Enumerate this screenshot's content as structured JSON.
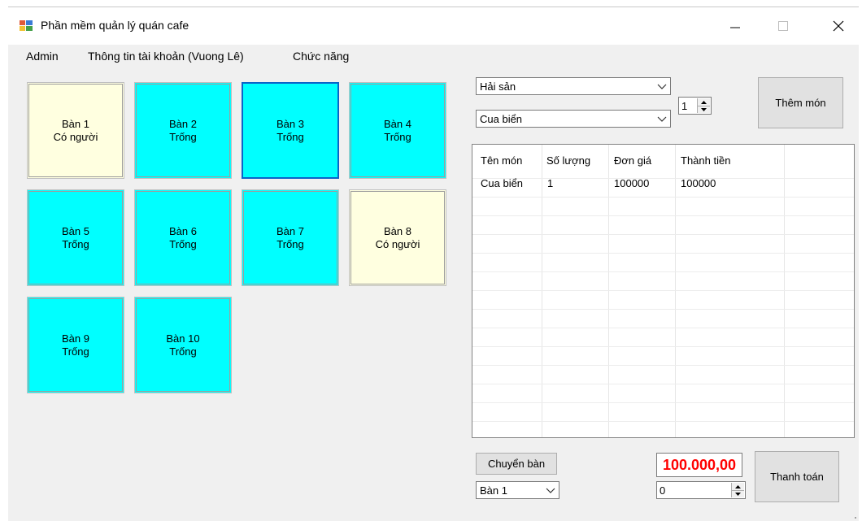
{
  "window": {
    "title": "Phần mềm quản lý quán cafe"
  },
  "menu": [
    {
      "label": "Admin"
    },
    {
      "label": "Thông tin tài khoản (Vuong Lê)"
    },
    {
      "label": "Chức năng"
    }
  ],
  "tables": [
    {
      "name": "Bàn 1",
      "status": "Có người"
    },
    {
      "name": "Bàn 2",
      "status": "Trống"
    },
    {
      "name": "Bàn 3",
      "status": "Trống"
    },
    {
      "name": "Bàn 4",
      "status": "Trống"
    },
    {
      "name": "Bàn 5",
      "status": "Trống"
    },
    {
      "name": "Bàn 6",
      "status": "Trống"
    },
    {
      "name": "Bàn 7",
      "status": "Trống"
    },
    {
      "name": "Bàn 8",
      "status": "Có người"
    },
    {
      "name": "Bàn 9",
      "status": "Trống"
    },
    {
      "name": "Bàn 10",
      "status": "Trống"
    }
  ],
  "order": {
    "category": "Hải sản",
    "food": "Cua biển",
    "quantity": "1",
    "add_label": "Thêm món"
  },
  "bill": {
    "columns": [
      "Tên món",
      "Số lượng",
      "Đơn giá",
      "Thành tiền"
    ],
    "rows": [
      [
        "Cua biển",
        "1",
        "100000",
        "100000"
      ]
    ]
  },
  "footer": {
    "switch_label": "Chuyển bàn",
    "switch_table": "Bàn 1",
    "total": "100.000,00",
    "discount": "0",
    "checkout_label": "Thanh toán"
  },
  "colors": {
    "free": "#00ffff",
    "occupied": "#ffffe0",
    "total_text": "#ff0000"
  }
}
